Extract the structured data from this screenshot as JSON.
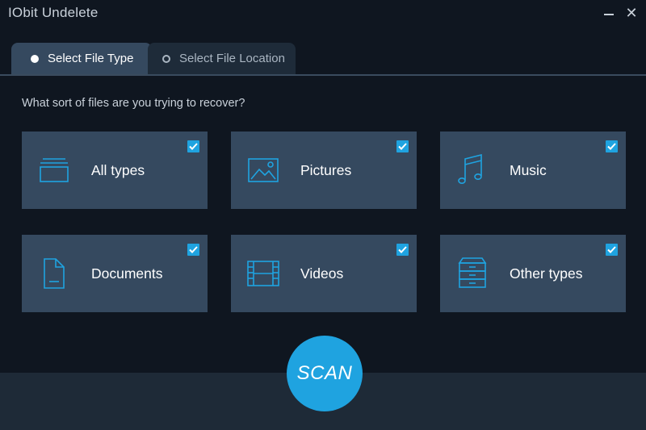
{
  "window": {
    "title": "IObit Undelete",
    "minimize_icon": "minimize-icon",
    "close_symbol": "✕"
  },
  "tabs": [
    {
      "label": "Select File Type",
      "active": true
    },
    {
      "label": "Select File Location",
      "active": false
    }
  ],
  "prompt": "What sort of files are you trying to recover?",
  "cards": [
    {
      "label": "All types",
      "icon": "stack-icon",
      "checked": true
    },
    {
      "label": "Pictures",
      "icon": "picture-icon",
      "checked": true
    },
    {
      "label": "Music",
      "icon": "music-note-icon",
      "checked": true
    },
    {
      "label": "Documents",
      "icon": "document-icon",
      "checked": true
    },
    {
      "label": "Videos",
      "icon": "film-icon",
      "checked": true
    },
    {
      "label": "Other types",
      "icon": "cabinet-icon",
      "checked": true
    }
  ],
  "scan_button": {
    "label": "SCAN"
  },
  "colors": {
    "accent": "#1fa3e0",
    "card_bg": "#35495f",
    "background": "#0f1620"
  }
}
